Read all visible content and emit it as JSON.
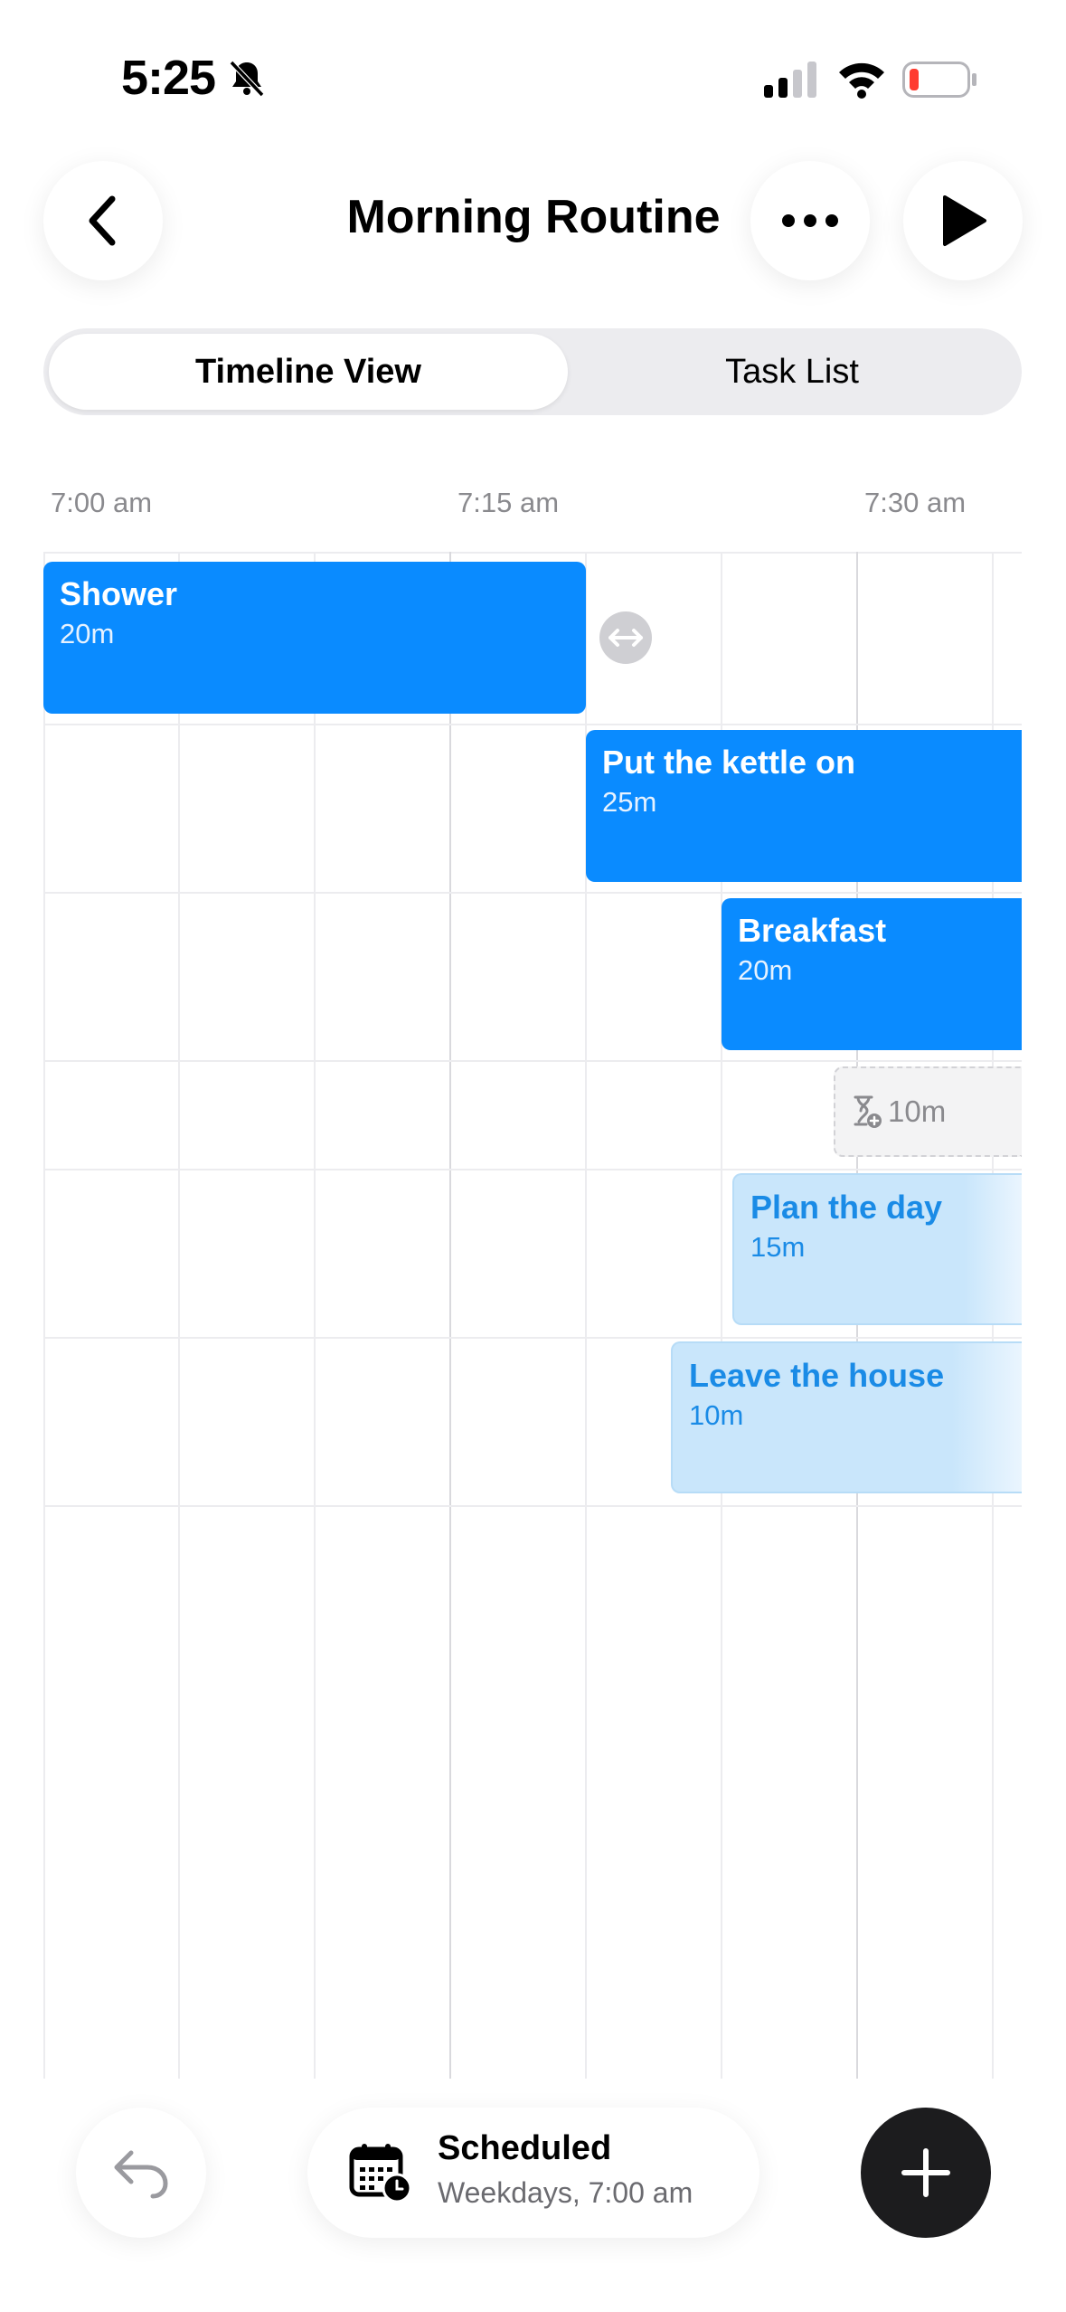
{
  "status_bar": {
    "time": "5:25",
    "icons": [
      "bell-slash-icon",
      "signal-icon",
      "wifi-icon",
      "battery-icon"
    ],
    "battery_color": "#ff3b30"
  },
  "header": {
    "title": "Morning Routine",
    "back_icon": "chevron-left-icon",
    "more_icon": "ellipsis-icon",
    "play_icon": "play-icon"
  },
  "view_toggle": {
    "options": [
      "Timeline View",
      "Task List"
    ],
    "selected": "Timeline View"
  },
  "timeline": {
    "time_labels": [
      "7:00 am",
      "7:15 am",
      "7:30 am"
    ],
    "tasks": [
      {
        "name": "Shower",
        "duration": "20m",
        "style": "solid"
      },
      {
        "name": "Put the kettle on",
        "duration": "25m",
        "style": "solid"
      },
      {
        "name": "Breakfast",
        "duration": "20m",
        "style": "solid"
      },
      {
        "name": "Plan the day",
        "duration": "15m",
        "style": "light"
      },
      {
        "name": "Leave the house",
        "duration": "10m",
        "style": "light"
      }
    ],
    "gap": {
      "duration": "10m",
      "icon": "hourglass-plus-icon"
    },
    "resize_handle_icon": "arrows-horizontal-icon",
    "accent_color": "#0a8bff"
  },
  "bottom_bar": {
    "undo_icon": "undo-icon",
    "schedule": {
      "title": "Scheduled",
      "subtitle": "Weekdays, 7:00 am",
      "icon": "calendar-clock-icon"
    },
    "add_icon": "plus-icon"
  }
}
